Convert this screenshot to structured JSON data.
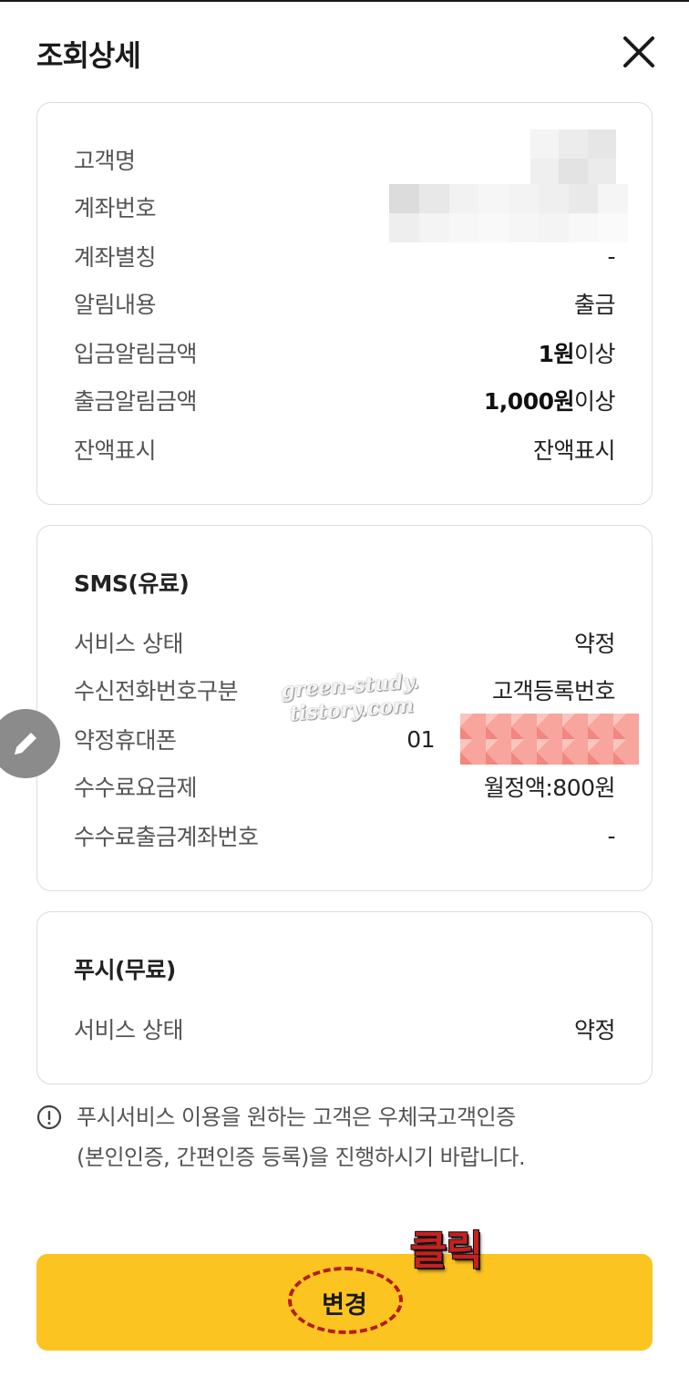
{
  "header": {
    "title": "조회상세"
  },
  "account": {
    "rows": [
      {
        "label": "고객명",
        "value": ""
      },
      {
        "label": "계좌번호",
        "value": ""
      },
      {
        "label": "계좌별칭",
        "value": "-"
      },
      {
        "label": "알림내용",
        "value": "출금"
      },
      {
        "label": "입금알림금액",
        "value_bold": "1원",
        "value_suffix": "이상"
      },
      {
        "label": "출금알림금액",
        "value_bold": "1,000원",
        "value_suffix": "이상"
      },
      {
        "label": "잔액표시",
        "value": "잔액표시"
      }
    ]
  },
  "sms": {
    "title": "SMS(유료)",
    "rows": [
      {
        "label": "서비스 상태",
        "value": "약정"
      },
      {
        "label": "수신전화번호구분",
        "value": "고객등록번호"
      },
      {
        "label": "약정휴대폰",
        "value": "01"
      },
      {
        "label": "수수료요금제",
        "value": "월정액:800원"
      },
      {
        "label": "수수료출금계좌번호",
        "value": "-"
      }
    ]
  },
  "push": {
    "title": "푸시(무료)",
    "rows": [
      {
        "label": "서비스 상태",
        "value": "약정"
      }
    ]
  },
  "notice": {
    "line1": "푸시서비스 이용을 원하는 고객은 우체국고객인증",
    "line2": "(본인인증, 간편인증 등록)을 진행하시기 바랍니다."
  },
  "watermark": {
    "line1": "green-study.",
    "line2": "tistory.com"
  },
  "action": {
    "label": "변경",
    "annotation": "클릭"
  },
  "colors": {
    "accent": "#fbc421",
    "annotation": "#c62020"
  }
}
